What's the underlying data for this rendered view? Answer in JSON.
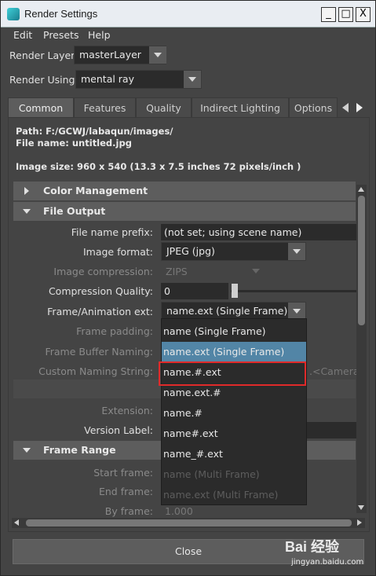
{
  "window": {
    "title": "Render Settings",
    "min": "_",
    "max": "□",
    "close": "X"
  },
  "menu": [
    "Edit",
    "Presets",
    "Help"
  ],
  "render_layer": {
    "label": "Render Layer",
    "value": "masterLayer"
  },
  "render_using": {
    "label": "Render Using",
    "value": "mental ray"
  },
  "tabs": [
    "Common",
    "Features",
    "Quality",
    "Indirect Lighting",
    "Options"
  ],
  "info": {
    "path": "Path: F:/GCWJ/labaqun/images/",
    "file_name": "File name:  untitled.jpg",
    "image_size": "Image size: 960 x 540 (13.3 x 7.5 inches 72 pixels/inch )"
  },
  "sections": {
    "color_management": "Color Management",
    "file_output": "File Output",
    "frame_range": "Frame Range"
  },
  "fields": {
    "file_name_prefix": {
      "label": "File name prefix:",
      "value": "(not set; using scene name)"
    },
    "image_format": {
      "label": "Image format:",
      "value": "JPEG (jpg)"
    },
    "image_compression": {
      "label": "Image compression:",
      "value": "ZIPS"
    },
    "compression_quality": {
      "label": "Compression Quality:",
      "value": "0"
    },
    "frame_animation_ext": {
      "label": "Frame/Animation ext:",
      "value": "name.ext (Single Frame)"
    },
    "frame_padding": {
      "label": "Frame padding:"
    },
    "frame_buffer_naming": {
      "label": "Frame Buffer Naming:"
    },
    "custom_naming_string": {
      "label": "Custom Naming String:",
      "value": ".<Camera"
    },
    "extension": {
      "label": "Extension:"
    },
    "version_label": {
      "label": "Version Label:"
    },
    "start_frame": {
      "label": "Start frame:"
    },
    "end_frame": {
      "label": "End frame:"
    },
    "by_frame": {
      "label": "By frame:",
      "value": "1.000"
    }
  },
  "popup_items": [
    {
      "label": "name (Single Frame)",
      "state": "normal"
    },
    {
      "label": "name.ext (Single Frame)",
      "state": "selected"
    },
    {
      "label": "name.#.ext",
      "state": "normal"
    },
    {
      "label": "name.ext.#",
      "state": "normal"
    },
    {
      "label": "name.#",
      "state": "normal"
    },
    {
      "label": "name#.ext",
      "state": "normal"
    },
    {
      "label": "name_#.ext",
      "state": "normal"
    },
    {
      "label": "name (Multi Frame)",
      "state": "disabled"
    },
    {
      "label": "name.ext (Multi Frame)",
      "state": "disabled"
    }
  ],
  "close_button": "Close",
  "watermark": {
    "brand": "Bai  经验",
    "url": "jingyan.baidu.com"
  },
  "colors": {
    "highlight_box": "#e02a2a",
    "selection": "#5285a6",
    "panel": "#444444"
  }
}
